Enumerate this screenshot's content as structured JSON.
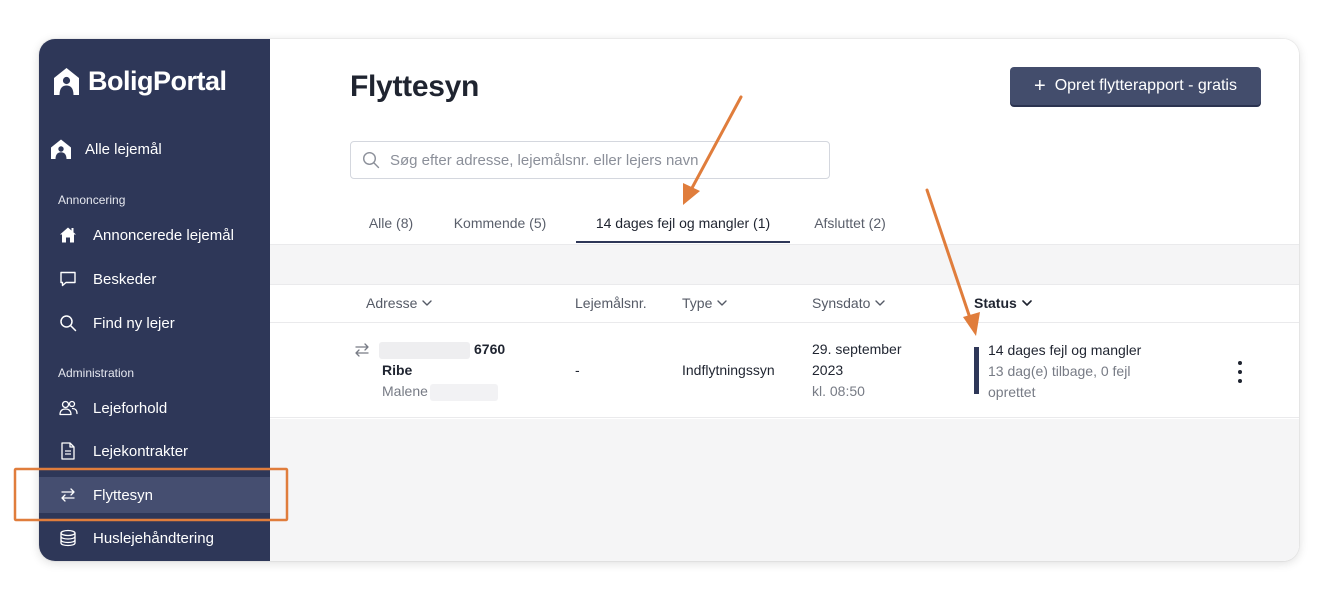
{
  "brand": {
    "name": "BoligPortal"
  },
  "sidebar": {
    "top_item": {
      "label": "Alle lejemål",
      "icon": "home-icon"
    },
    "sections": [
      {
        "label": "Annoncering",
        "items": [
          {
            "label": "Annoncerede lejemål",
            "icon": "house-icon"
          },
          {
            "label": "Beskeder",
            "icon": "chat-icon"
          },
          {
            "label": "Find ny lejer",
            "icon": "search-icon"
          }
        ]
      },
      {
        "label": "Administration",
        "items": [
          {
            "label": "Lejeforhold",
            "icon": "users-icon"
          },
          {
            "label": "Lejekontrakter",
            "icon": "document-icon"
          },
          {
            "label": "Flyttesyn",
            "icon": "arrows-exchange-icon",
            "active": true
          },
          {
            "label": "Huslejehåndtering",
            "icon": "coins-icon"
          }
        ]
      }
    ]
  },
  "header": {
    "title": "Flyttesyn",
    "primary_button": {
      "label": "Opret flytterapport - gratis",
      "icon": "plus-icon"
    }
  },
  "search": {
    "placeholder": "Søg efter adresse, lejemålsnr. eller lejers navn",
    "value": ""
  },
  "tabs": [
    {
      "label": "Alle (8)",
      "active": false
    },
    {
      "label": "Kommende (5)",
      "active": false
    },
    {
      "label": "14 dages fejl og mangler (1)",
      "active": true
    },
    {
      "label": "Afsluttet (2)",
      "active": false
    }
  ],
  "table": {
    "columns": [
      {
        "label": "Adresse",
        "sortable": true
      },
      {
        "label": "Lejemålsnr.",
        "sortable": false
      },
      {
        "label": "Type",
        "sortable": true
      },
      {
        "label": "Synsdato",
        "sortable": true
      },
      {
        "label": "Status",
        "sortable": true,
        "active": true
      }
    ],
    "rows": [
      {
        "address_zip": "6760",
        "address_city": "Ribe",
        "tenant_first_name": "Malene",
        "lease_no": "-",
        "type": "Indflytningssyn",
        "date_line1": "29. september",
        "date_line2": "2023",
        "time": "kl. 08:50",
        "status_title": "14 dages fejl og mangler",
        "status_detail_line1": "13 dag(e) tilbage, 0 fejl",
        "status_detail_line2": "oprettet"
      }
    ]
  },
  "colors": {
    "sidebar_bg": "#2e3758",
    "sidebar_active": "#454e70",
    "primary_button": "#434d6c",
    "annotation": "#e07d3c"
  }
}
